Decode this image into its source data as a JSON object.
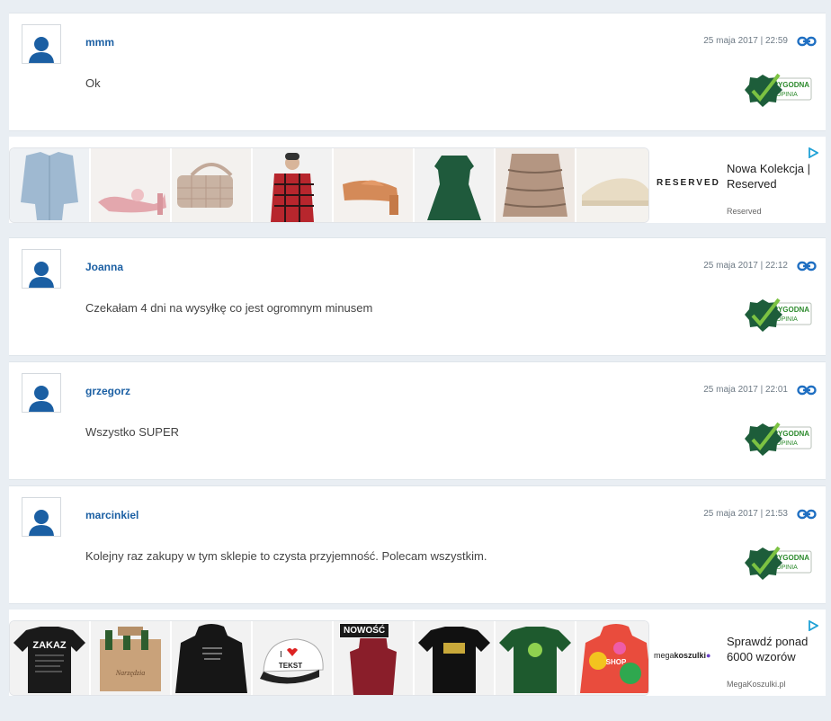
{
  "reviews": [
    {
      "author": "mmm",
      "date": "25 maja 2017 | 22:59",
      "text": "Ok",
      "badge_line1": "WIARYGODNA",
      "badge_line2": "OPINIA"
    },
    {
      "author": "Joanna",
      "date": "25 maja 2017 | 22:12",
      "text": "Czekałam 4 dni na wysyłkę co jest ogromnym minusem",
      "badge_line1": "WIARYGODNA",
      "badge_line2": "OPINIA"
    },
    {
      "author": "grzegorz",
      "date": "25 maja 2017 | 22:01",
      "text": "Wszystko SUPER",
      "badge_line1": "WIARYGODNA",
      "badge_line2": "OPINIA"
    },
    {
      "author": "marcinkiel",
      "date": "25 maja 2017 | 21:53",
      "text": "Kolejny raz zakupy w tym sklepie to czysta przyjemność. Polecam wszystkim.",
      "badge_line1": "WIARYGODNA",
      "badge_line2": "OPINIA"
    }
  ],
  "ads": [
    {
      "brand": "RESERVED",
      "title": "Nowa Kolekcja | Reserved",
      "source": "Reserved",
      "products": [
        "denim-jacket",
        "pink-slingback-heels",
        "beige-quilted-bag",
        "red-plaid-shirt",
        "orange-mule-sandals",
        "green-dress",
        "snakeskin-print-skirt",
        "cream-sneakers"
      ]
    },
    {
      "brand_prefix": "mega",
      "brand_bold": "koszulki",
      "title": "Sprawdź ponad 6000 wzorów",
      "source": "MegaKoszulki.pl",
      "tile_badge": "NOWOŚĆ",
      "tile_text_1": "ZAKAZ",
      "tile_text_2": "Narzędzia",
      "tile_text_3": "I",
      "tile_text_4": "TEKST",
      "tile_text_5": "SHOP",
      "products": [
        "black-tshirt-zakaz",
        "wooden-beer-crate",
        "black-hoodie",
        "trucker-cap",
        "red-apron",
        "black-tshirt-print",
        "green-tshirt-print",
        "colorful-hoodie"
      ]
    }
  ],
  "colors": {
    "author": "#1b5fa3",
    "badge_green": "#2e8b2e",
    "link_icon": "#1f6fc2"
  }
}
